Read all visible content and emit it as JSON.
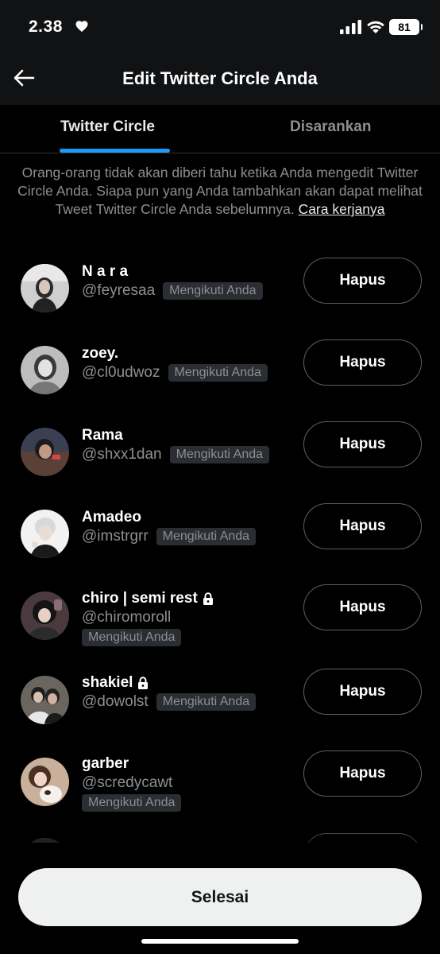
{
  "status_bar": {
    "time": "2.38",
    "battery": "81"
  },
  "header": {
    "title": "Edit Twitter Circle Anda"
  },
  "tabs": [
    {
      "label": "Twitter Circle",
      "active": true
    },
    {
      "label": "Disarankan",
      "active": false
    }
  ],
  "notice": {
    "text": "Orang-orang tidak akan diberi tahu ketika Anda mengedit Twitter Circle Anda. Siapa pun yang Anda tambahkan akan dapat melihat Tweet Twitter Circle Anda sebelumnya.",
    "link": "Cara kerjanya"
  },
  "members": [
    {
      "name": "N a r a",
      "handle": "@feyresaa",
      "badge": "Mengikuti Anda",
      "locked": false,
      "button": "Hapus"
    },
    {
      "name": "zoey.",
      "handle": "@cl0udwoz",
      "badge": "Mengikuti Anda",
      "locked": false,
      "button": "Hapus"
    },
    {
      "name": "Rama",
      "handle": "@shxx1dan",
      "badge": "Mengikuti Anda",
      "locked": false,
      "button": "Hapus"
    },
    {
      "name": "Amadeo",
      "handle": "@imstrgrr",
      "badge": "Mengikuti Anda",
      "locked": false,
      "button": "Hapus"
    },
    {
      "name": "chiro | semi rest",
      "handle": "@chiromoroll",
      "badge": "Mengikuti Anda",
      "locked": true,
      "button": "Hapus"
    },
    {
      "name": "shakiel",
      "handle": "@dowolst",
      "badge": "Mengikuti Anda",
      "locked": true,
      "button": "Hapus"
    },
    {
      "name": "garber",
      "handle": "@scredycawt",
      "badge": "Mengikuti Anda",
      "locked": false,
      "button": "Hapus"
    }
  ],
  "footer": {
    "done_label": "Selesai"
  },
  "colors": {
    "accent": "#1d9bf0",
    "background": "#000000",
    "secondary_text": "#8b8f94"
  }
}
